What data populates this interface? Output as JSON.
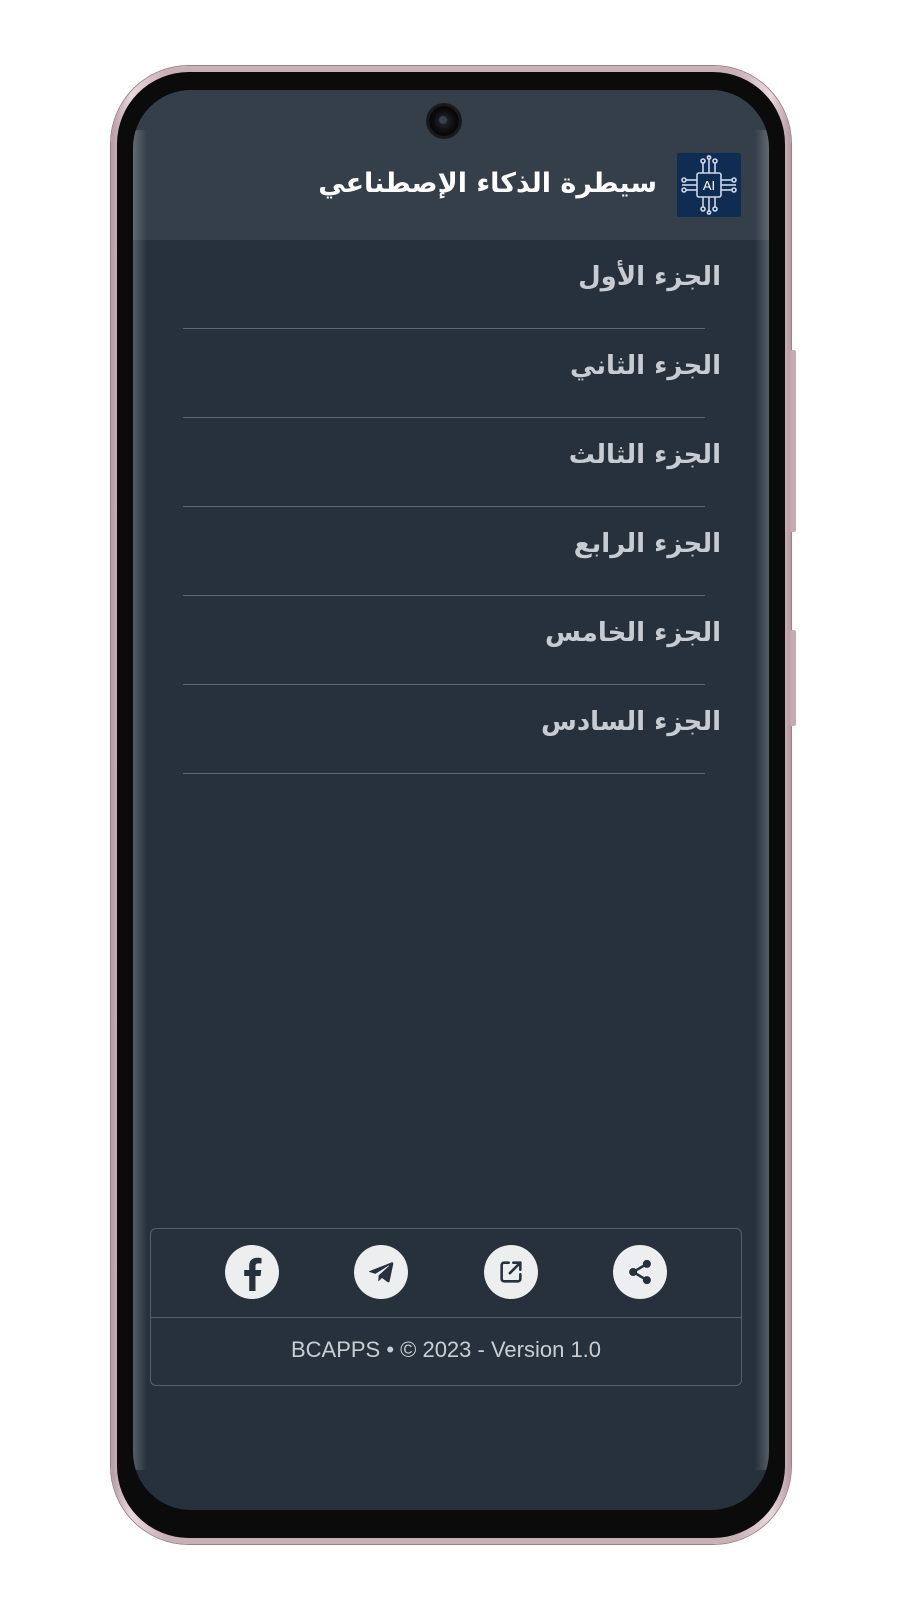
{
  "app": {
    "title": "سيطرة الذكاء الإصطناعي",
    "logo_text": "AI"
  },
  "menu": {
    "items": [
      {
        "label": "الجزء الأول"
      },
      {
        "label": "الجزء الثاني"
      },
      {
        "label": "الجزء الثالث"
      },
      {
        "label": "الجزء الرابع"
      },
      {
        "label": "الجزء الخامس"
      },
      {
        "label": "الجزء السادس"
      }
    ]
  },
  "footer": {
    "social": [
      {
        "icon": "facebook-icon"
      },
      {
        "icon": "telegram-icon"
      },
      {
        "icon": "open-external-icon"
      },
      {
        "icon": "share-icon"
      }
    ],
    "copyright": "BCAPPS • © 2023 - Version 1.0"
  },
  "colors": {
    "screen_bg": "#26313b",
    "header_bg": "#353f49",
    "logo_bg": "#0f2c52",
    "text": "#c7ccd2",
    "icon_bg": "#eceef0"
  }
}
